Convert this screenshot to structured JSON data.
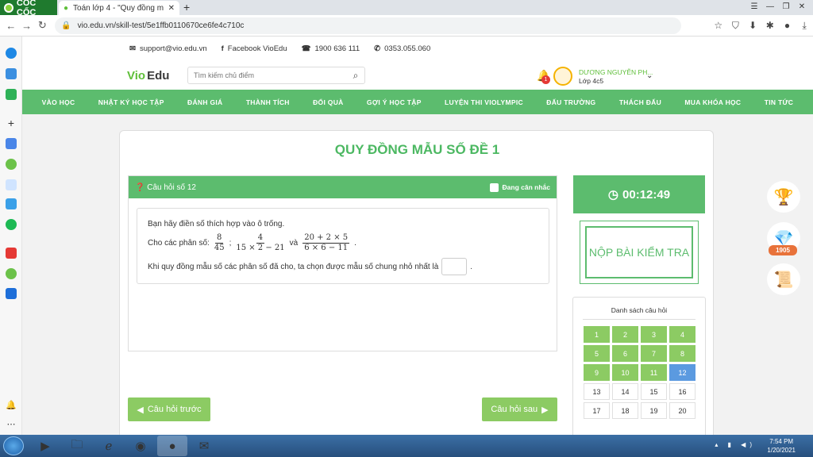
{
  "browser": {
    "brand": "CỐC CỐC",
    "tab_title": "Toán lớp 4 - \"Quy đồng mẫu",
    "url": "vio.edu.vn/skill-test/5e1ffb0110670ce6fe4c710c"
  },
  "header": {
    "email": "support@vio.edu.vn",
    "facebook": "Facebook VioEdu",
    "phone1": "1900 636 111",
    "phone2": "0353.055.060",
    "logo_vio": "Vio",
    "logo_edu": "Edu",
    "search_placeholder": "Tìm kiếm chủ điểm",
    "notif_count": "1",
    "user_name": "DƯƠNG NGUYỄN PH...",
    "user_grade": "Lớp 4c5"
  },
  "menu": [
    "VÀO HỌC",
    "NHẬT KÝ HỌC TẬP",
    "ĐÁNH GIÁ",
    "THÀNH TÍCH",
    "ĐỔI QUÀ",
    "GỢI Ý HỌC TẬP",
    "LUYỆN THI VIOLYMPIC",
    "ĐẤU TRƯỜNG",
    "THÁCH ĐẤU",
    "MUA KHÓA HỌC",
    "TIN TỨC"
  ],
  "quiz": {
    "title": "QUY ĐỒNG MẪU SỐ ĐỀ 1",
    "question_label": "Câu hỏi số 12",
    "consider_label": "Đang cân nhắc",
    "instruction": "Bạn hãy điền số thích hợp vào ô trống.",
    "given_prefix": "Cho các phân số:",
    "f1_num": "8",
    "f1_den": "45",
    "sep": ";",
    "f2_num": "4",
    "f2_den": "15 × 2 − 21",
    "and_word": "và",
    "f3_num": "20 + 2 × 5",
    "f3_den": "6 × 6 − 11",
    "end_dot": ".",
    "question_text": "Khi quy đồng mẫu số các phân số đã cho, ta chọn được mẫu số chung nhỏ nhất là",
    "prev_label": "Câu hỏi trước",
    "next_label": "Câu hỏi sau",
    "timer": "00:12:49",
    "submit_label": "NỘP BÀI KIỂM TRA",
    "list_title": "Danh sách câu hỏi",
    "numbers": [
      "1",
      "2",
      "3",
      "4",
      "5",
      "6",
      "7",
      "8",
      "9",
      "10",
      "11",
      "12",
      "13",
      "14",
      "15",
      "16",
      "17",
      "18",
      "19",
      "20"
    ],
    "done_count": 11,
    "current": 12
  },
  "right_icons": {
    "points": "1905"
  },
  "taskbar": {
    "time": "7:54 PM",
    "date": "1/20/2021"
  }
}
